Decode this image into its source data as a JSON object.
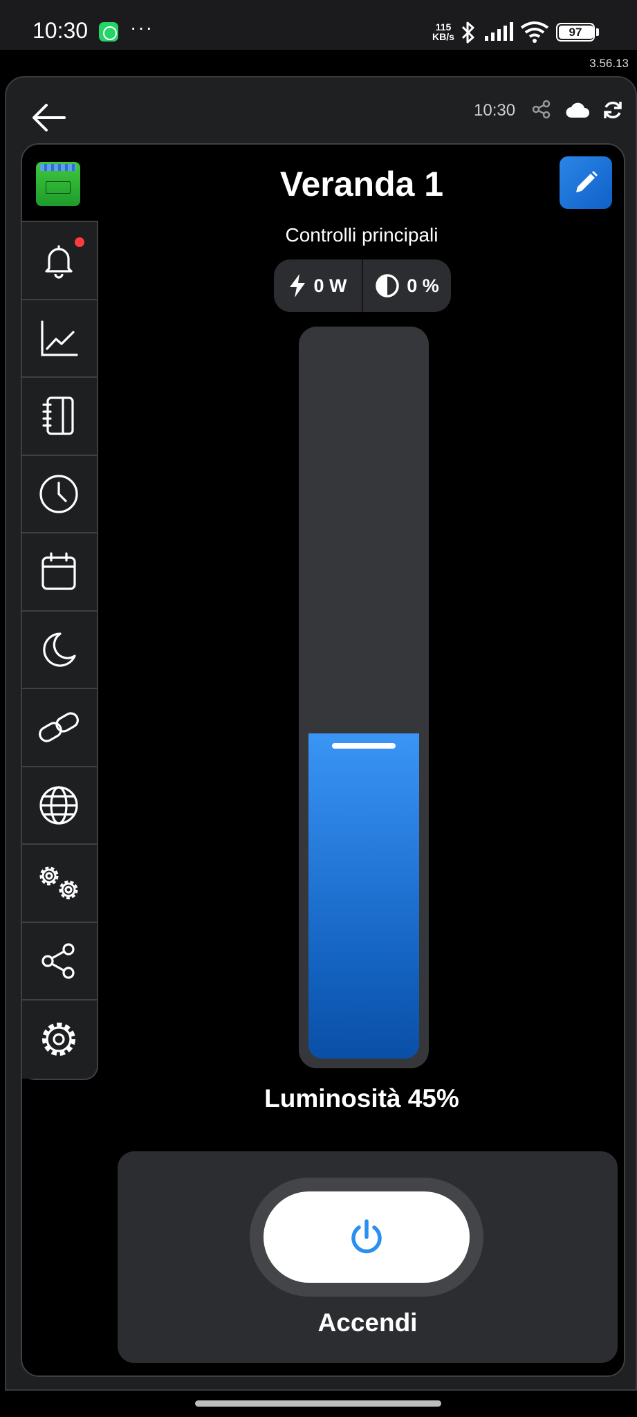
{
  "status_bar": {
    "time": "10:30",
    "net_speed_value": "115",
    "net_speed_unit": "KB/s",
    "battery": "97",
    "notification_dots": "···"
  },
  "app_version": "3.56.13",
  "header": {
    "time": "10:30",
    "icons": [
      "back-arrow-icon",
      "share-icon",
      "cloud-icon",
      "sync-icon"
    ]
  },
  "device": {
    "title": "Veranda 1",
    "subtitle": "Controlli principali",
    "power_reading": "0 W",
    "dim_reading": "0 %",
    "brightness_label": "Luminosità 45%",
    "brightness_level": 0.45,
    "power_button_label": "Accendi"
  },
  "sidebar": {
    "items": [
      {
        "name": "notifications",
        "icon": "bell-icon",
        "has_badge": true
      },
      {
        "name": "statistics",
        "icon": "chart-line-icon"
      },
      {
        "name": "logbook",
        "icon": "notebook-icon"
      },
      {
        "name": "timers",
        "icon": "clock-icon"
      },
      {
        "name": "schedules",
        "icon": "calendar-icon"
      },
      {
        "name": "night-mode",
        "icon": "moon-icon"
      },
      {
        "name": "links",
        "icon": "link-icon"
      },
      {
        "name": "web",
        "icon": "globe-icon"
      },
      {
        "name": "advanced-settings",
        "icon": "gears-icon"
      },
      {
        "name": "share",
        "icon": "share-nodes-icon"
      },
      {
        "name": "settings",
        "icon": "gear-icon"
      }
    ]
  },
  "colors": {
    "accent": "#2b86e6",
    "badge": "#ff3b3b",
    "panel": "#2c2d30",
    "background": "#000000"
  }
}
